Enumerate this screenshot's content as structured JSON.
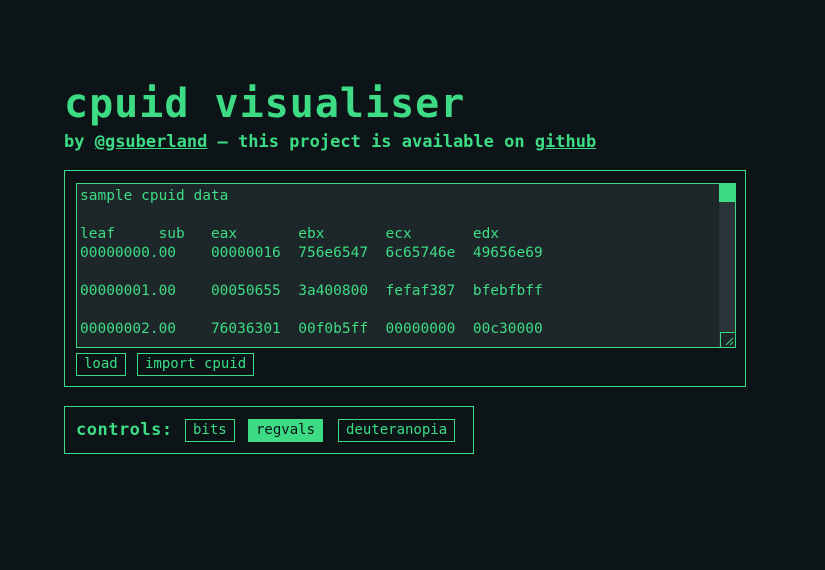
{
  "header": {
    "title": "cpuid visualiser",
    "by_prefix": "by ",
    "author_link": "@gsuberland",
    "middle_text": " — this project is available on ",
    "repo_link": "github"
  },
  "input": {
    "lines": [
      "sample cpuid data",
      "",
      "leaf     sub   eax       ebx       ecx       edx",
      "00000000.00    00000016  756e6547  6c65746e  49656e69",
      "",
      "00000001.00    00050655  3a400800  fefaf387  bfebfbff",
      "",
      "00000002.00    76036301  00f0b5ff  00000000  00c30000"
    ],
    "load_label": "load",
    "import_label": "import cpuid"
  },
  "controls": {
    "label": "controls:",
    "buttons": [
      {
        "label": "bits",
        "active": false
      },
      {
        "label": "regvals",
        "active": true
      },
      {
        "label": "deuteranopia",
        "active": false
      }
    ]
  },
  "colors": {
    "background": "#0c1418",
    "accent": "#3ddc84",
    "textarea_bg": "#1d2629"
  }
}
